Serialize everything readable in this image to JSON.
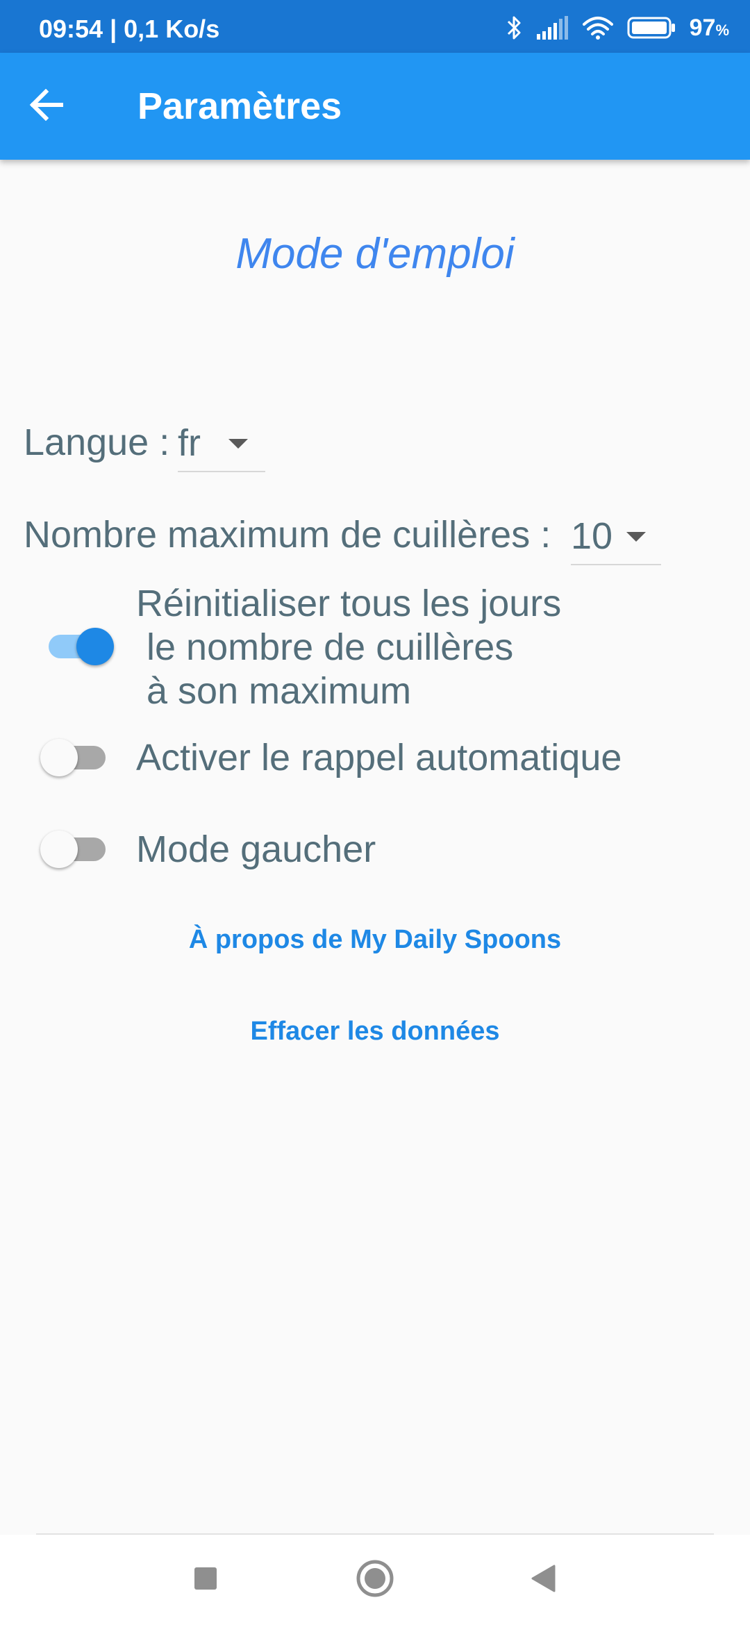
{
  "status_bar": {
    "time_speed": "09:54 | 0,1 Ko/s",
    "battery_value": "97",
    "battery_unit": "%"
  },
  "app_bar": {
    "title": "Paramètres",
    "back_icon": "arrow-back-icon"
  },
  "content": {
    "help_link": "Mode d'emploi",
    "language": {
      "label": "Langue : ",
      "value": "fr"
    },
    "max_spoons": {
      "label": "Nombre maximum de cuillères : ",
      "value": "10"
    },
    "toggles": [
      {
        "line1": "Réinitialiser tous les jours",
        "line2": " le nombre de cuillères",
        "line3": " à son maximum",
        "checked": true
      },
      {
        "label": "Activer le rappel automatique",
        "checked": false
      },
      {
        "label": "Mode gaucher",
        "checked": false
      }
    ],
    "about_link": "À propos de My Daily Spoons",
    "clear_link": "Effacer les données"
  },
  "colors": {
    "status_bar": "#1976d2",
    "app_bar": "#2196f3",
    "accent": "#1e88e5",
    "link_italic": "#3f86ee",
    "text": "#546e7a",
    "background": "#fafafa"
  }
}
